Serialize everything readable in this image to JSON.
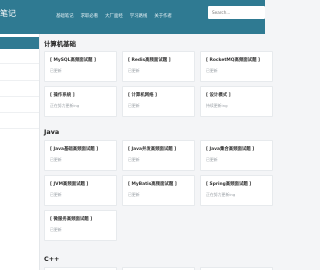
{
  "header": {
    "brand": "笔记",
    "nav": [
      "基础笔记",
      "求职必看",
      "大厂面经",
      "学习路线",
      "关于作者"
    ],
    "search_placeholder": "Search..."
  },
  "sections": [
    {
      "title": "计算机基础",
      "cards": [
        {
          "title": "[ MySQL高频面试题 ]",
          "sub": "已更新"
        },
        {
          "title": "[ Redis高频面试题 ]",
          "sub": "已更新"
        },
        {
          "title": "[ RocketMQ高频面试题 ]",
          "sub": "已更新"
        },
        {
          "title": "[ 操作系统 ]",
          "sub": "正在努力更新ing"
        },
        {
          "title": "[ 计算机网络 ]",
          "sub": "已更新"
        },
        {
          "title": "[ 设计模式 ]",
          "sub": "持续更新ing"
        }
      ]
    },
    {
      "title": "Java",
      "cards": [
        {
          "title": "[ Java基础高频面试题 ]",
          "sub": "已更新"
        },
        {
          "title": "[ Java并发高频面试题 ]",
          "sub": "已更新"
        },
        {
          "title": "[ Java集合高频面试题 ]",
          "sub": "已更新"
        },
        {
          "title": "[ JVM高频面试题 ]",
          "sub": "已更新"
        },
        {
          "title": "[ MyBatis高频面试题 ]",
          "sub": "已更新"
        },
        {
          "title": "[ Spring高频面试题 ]",
          "sub": "正在努力更新ing"
        },
        {
          "title": "[ 微服务高频面试题 ]",
          "sub": "已更新"
        }
      ]
    },
    {
      "title": "C++",
      "cards": []
    }
  ],
  "colors": {
    "header_bg": "#2f7a92",
    "sidebar_active": "#2f7a92"
  }
}
